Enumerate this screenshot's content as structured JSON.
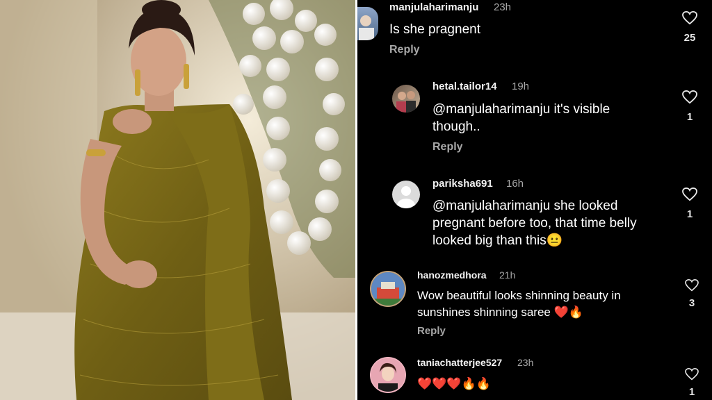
{
  "comments": [
    {
      "username": "manjulaharimanju",
      "time": "23h",
      "text": "Is she pragnent",
      "reply": "Reply",
      "likes": "25"
    },
    {
      "username": "hetal.tailor14",
      "time": "19h",
      "text": "@manjulaharimanju it's visible\nthough..",
      "reply": "Reply",
      "likes": "1"
    },
    {
      "username": "pariksha691",
      "time": "16h",
      "text": "@manjulaharimanju she looked\npregnant  before too, that time belly\nlooked big than this😐",
      "likes": "1"
    },
    {
      "username": "hanozmedhora",
      "time": "21h",
      "text": "Wow beautiful looks shinning beauty in\nsunshines shinning saree ❤️🔥",
      "reply": "Reply",
      "likes": "3"
    },
    {
      "username": "taniachatterjee527",
      "time": "23h",
      "text": "❤️❤️❤️🔥🔥",
      "likes": "1"
    }
  ],
  "icons": {
    "like": "heart-outline-icon",
    "avatar_placeholder": "default-avatar-icon"
  }
}
